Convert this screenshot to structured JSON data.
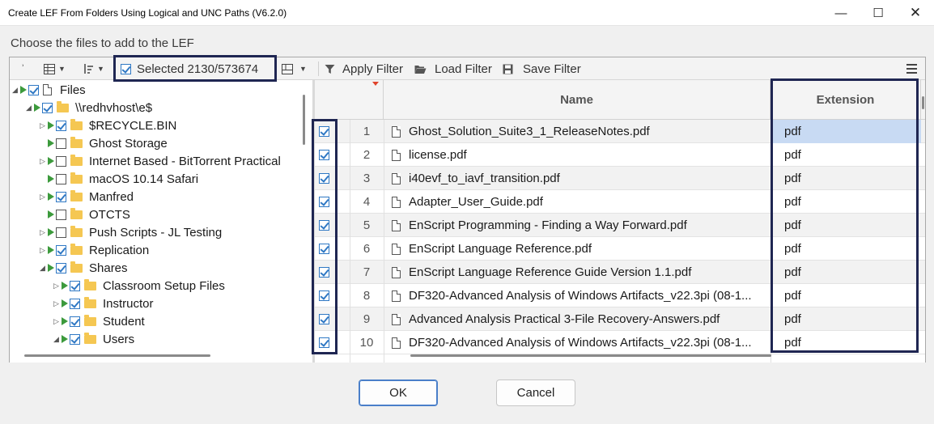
{
  "window": {
    "title": "Create LEF From Folders Using Logical and UNC Paths (V6.2.0)",
    "minimize_glyph": "—",
    "maximize_glyph": "☐",
    "close_glyph": "✕"
  },
  "prompt": "Choose the files to add to the LEF",
  "toolbar": {
    "selected_label": "Selected 2130/573674",
    "apply_filter": "Apply Filter",
    "load_filter": "Load Filter",
    "save_filter": "Save Filter",
    "icons": [
      "refresh-icon",
      "table-icon",
      "sort-icon",
      "checkbox-icon",
      "layout-icon",
      "filter-icon",
      "folder-open-icon",
      "save-icon",
      "menu-icon"
    ]
  },
  "tree": {
    "items": [
      {
        "label": "Files",
        "level": 0,
        "expanded": true,
        "checked": true,
        "kind": "file"
      },
      {
        "label": "\\\\redhvhost\\e$",
        "level": 1,
        "expanded": true,
        "checked": true,
        "kind": "folder"
      },
      {
        "label": "$RECYCLE.BIN",
        "level": 2,
        "expanded": false,
        "checked": true,
        "kind": "folder"
      },
      {
        "label": "Ghost Storage",
        "level": 2,
        "expanded": null,
        "checked": false,
        "kind": "folder"
      },
      {
        "label": "Internet Based - BitTorrent Practical",
        "level": 2,
        "expanded": false,
        "checked": false,
        "kind": "folder"
      },
      {
        "label": "macOS 10.14 Safari",
        "level": 2,
        "expanded": null,
        "checked": false,
        "kind": "folder"
      },
      {
        "label": "Manfred",
        "level": 2,
        "expanded": false,
        "checked": true,
        "kind": "folder"
      },
      {
        "label": "OTCTS",
        "level": 2,
        "expanded": null,
        "checked": false,
        "kind": "folder"
      },
      {
        "label": "Push Scripts - JL Testing",
        "level": 2,
        "expanded": false,
        "checked": false,
        "kind": "folder"
      },
      {
        "label": "Replication",
        "level": 2,
        "expanded": false,
        "checked": true,
        "kind": "folder"
      },
      {
        "label": "Shares",
        "level": 2,
        "expanded": true,
        "checked": true,
        "kind": "folder"
      },
      {
        "label": "Classroom Setup Files",
        "level": 3,
        "expanded": false,
        "checked": true,
        "kind": "folder"
      },
      {
        "label": "Instructor",
        "level": 3,
        "expanded": false,
        "checked": true,
        "kind": "folder"
      },
      {
        "label": "Student",
        "level": 3,
        "expanded": false,
        "checked": true,
        "kind": "folder"
      },
      {
        "label": "Users",
        "level": 3,
        "expanded": true,
        "checked": true,
        "kind": "folder"
      }
    ]
  },
  "grid": {
    "columns": {
      "name": "Name",
      "extension": "Extension"
    },
    "rows": [
      {
        "n": "1",
        "name": "Ghost_Solution_Suite3_1_ReleaseNotes.pdf",
        "ext": "pdf"
      },
      {
        "n": "2",
        "name": "license.pdf",
        "ext": "pdf"
      },
      {
        "n": "3",
        "name": "i40evf_to_iavf_transition.pdf",
        "ext": "pdf"
      },
      {
        "n": "4",
        "name": "Adapter_User_Guide.pdf",
        "ext": "pdf"
      },
      {
        "n": "5",
        "name": "EnScript Programming - Finding a Way Forward.pdf",
        "ext": "pdf"
      },
      {
        "n": "6",
        "name": "EnScript Language Reference.pdf",
        "ext": "pdf"
      },
      {
        "n": "7",
        "name": "EnScript Language Reference Guide Version 1.1.pdf",
        "ext": "pdf"
      },
      {
        "n": "8",
        "name": "DF320-Advanced Analysis of Windows Artifacts_v22.3pi (08-1...",
        "ext": "pdf"
      },
      {
        "n": "9",
        "name": "Advanced Analysis Practical 3-File Recovery-Answers.pdf",
        "ext": "pdf"
      },
      {
        "n": "10",
        "name": "DF320-Advanced Analysis of Windows Artifacts_v22.3pi (08-1...",
        "ext": "pdf"
      }
    ]
  },
  "buttons": {
    "ok": "OK",
    "cancel": "Cancel"
  },
  "colors": {
    "highlight_border": "#1f2652",
    "accent_check": "#2f78c4",
    "selected_cell": "#c8daf3",
    "play_green": "#3c9a3c",
    "folder_yellow": "#f5c752"
  }
}
